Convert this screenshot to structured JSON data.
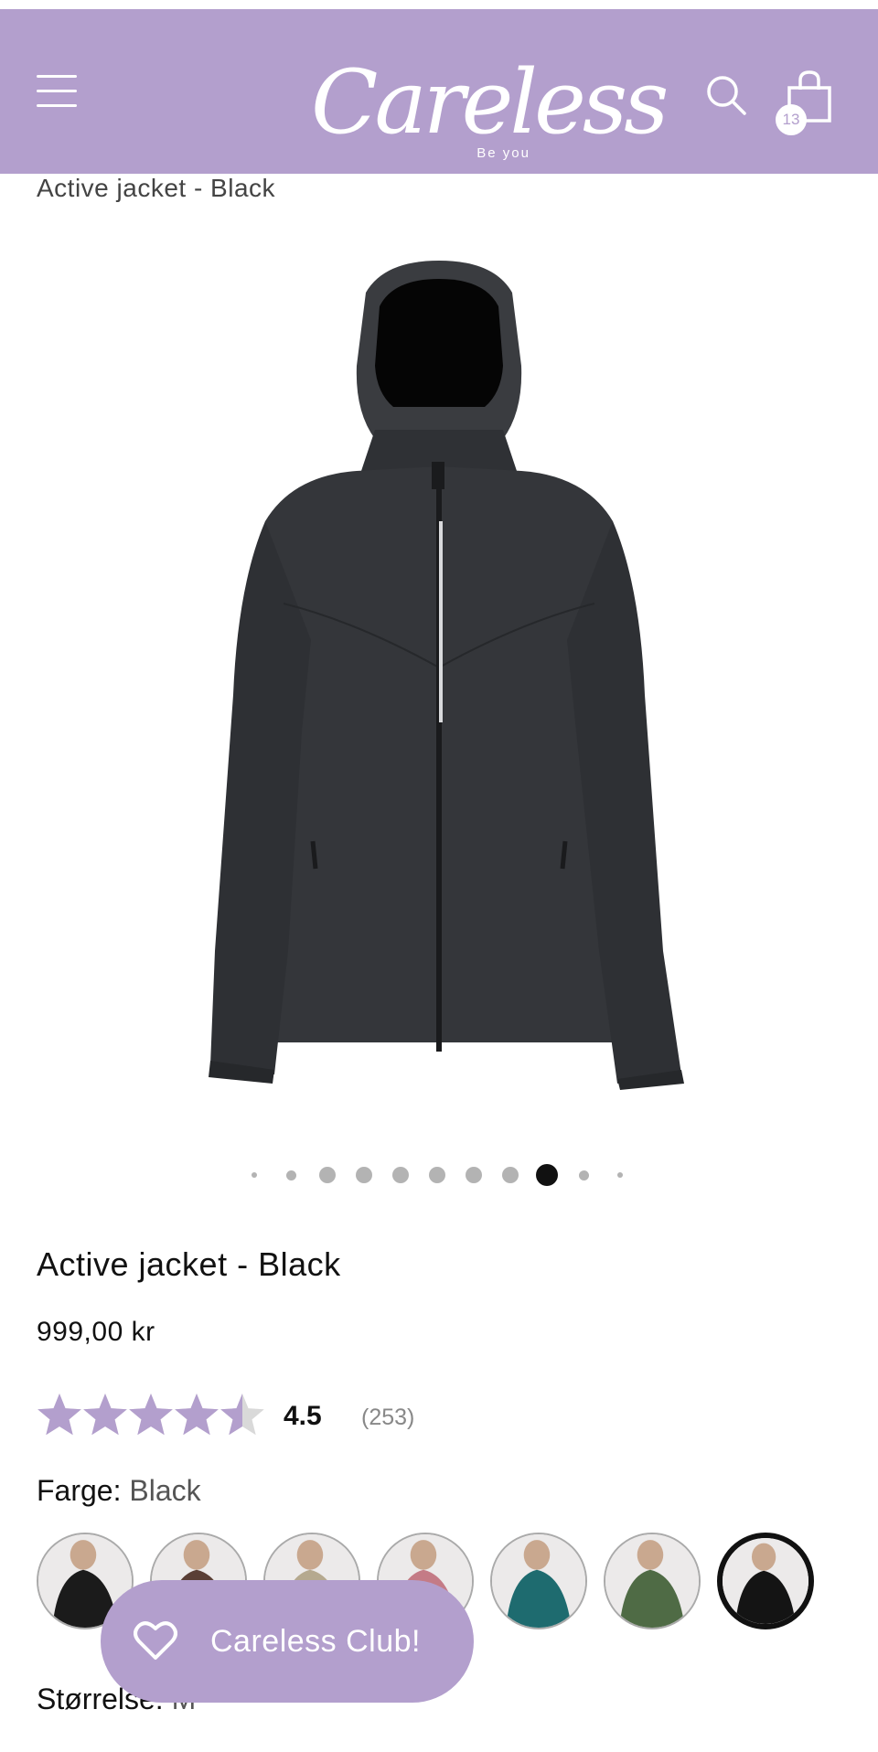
{
  "header": {
    "logo_text": "Careless",
    "logo_tagline": "Be you",
    "cart_count": "13",
    "background_color": "#b39fcd",
    "icons": [
      "hamburger-menu-icon",
      "search-icon",
      "shopping-bag-icon"
    ]
  },
  "breadcrumb": {
    "title": "Active jacket - Black"
  },
  "gallery": {
    "image": "black-softshell-jacket-with-hood",
    "dot_count": 11,
    "active_index": 8
  },
  "product": {
    "name": "Active jacket - Black",
    "price": "999,00 kr"
  },
  "rating": {
    "value": "4.5",
    "count": "(253)",
    "stars": 4.5,
    "star_color": "#b39fcd"
  },
  "color": {
    "label": "Farge:",
    "selected": "Black",
    "options": [
      {
        "name": "black-swatch",
        "tone": "#1b1b1b"
      },
      {
        "name": "brown-swatch",
        "tone": "#5a3f36"
      },
      {
        "name": "beige-swatch",
        "tone": "#b5a98f"
      },
      {
        "name": "pink-swatch",
        "tone": "#c47b86"
      },
      {
        "name": "teal-swatch",
        "tone": "#1e6b6f"
      },
      {
        "name": "green-swatch",
        "tone": "#4f6b45"
      },
      {
        "name": "black-selected-swatch",
        "tone": "#141414"
      }
    ]
  },
  "club_button": {
    "label": "Careless Club!",
    "icon": "heart-icon"
  },
  "size": {
    "label": "Størrelse:",
    "selected": "M"
  }
}
